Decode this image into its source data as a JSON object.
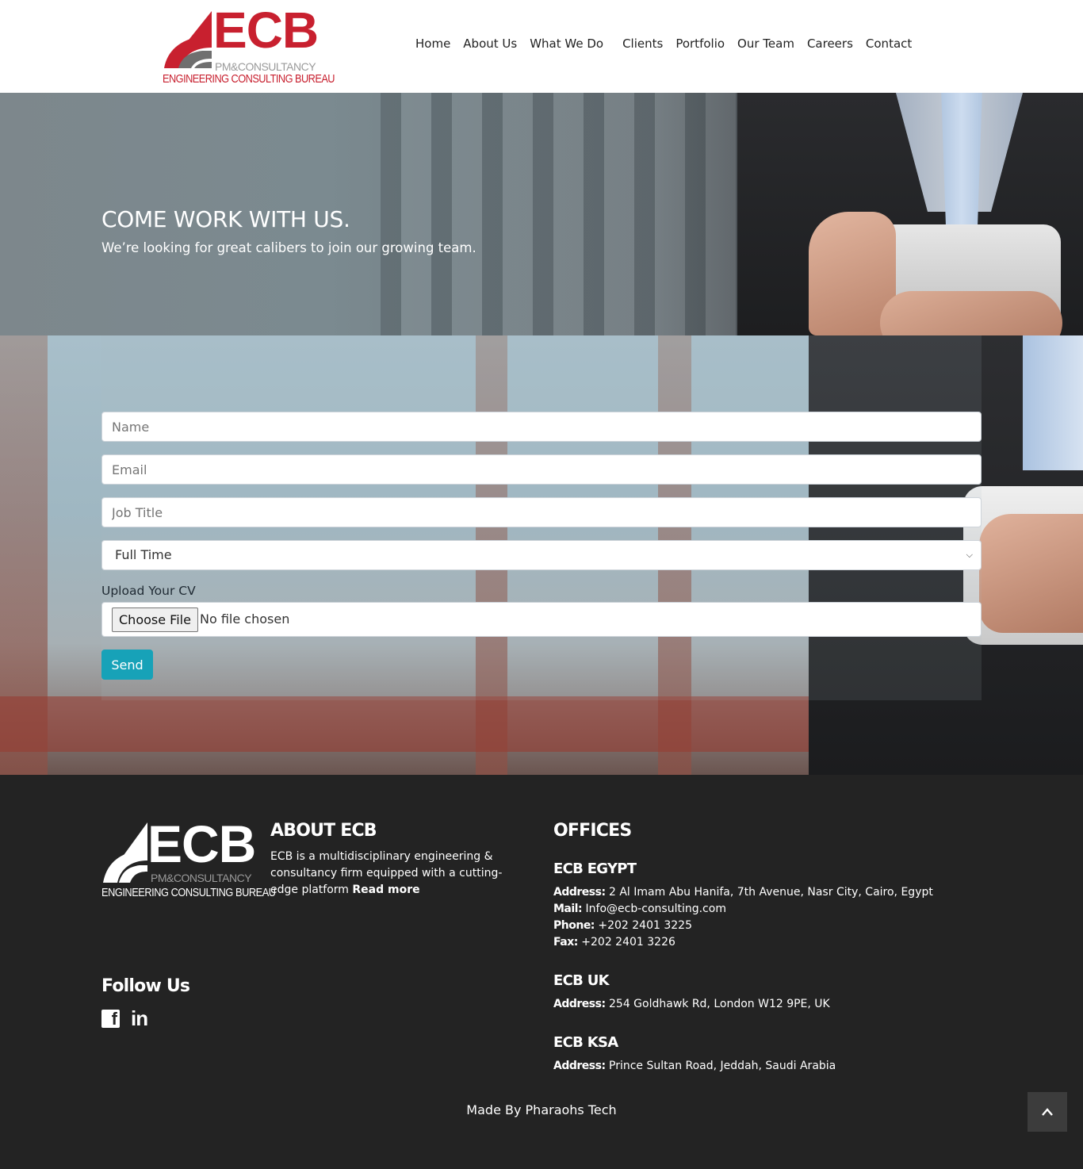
{
  "brand": {
    "logo_main": "ECB",
    "logo_sub": "PM&CONSULTANCY",
    "logo_tagline": "ENGINEERING CONSULTING BUREAU",
    "accent_color": "#c8202f"
  },
  "nav": {
    "items": [
      "Home",
      "About Us",
      "What We Do",
      "Clients",
      "Portfolio",
      "Our Team",
      "Careers",
      "Contact"
    ]
  },
  "hero": {
    "title": "COME WORK WITH US.",
    "subtitle": "We’re looking for great calibers to join our growing team."
  },
  "form": {
    "name_placeholder": "Name",
    "email_placeholder": "Email",
    "job_title_placeholder": "Job Title",
    "employment_type": "Full Time",
    "cv_label": "Upload Your CV",
    "file_button": "Choose File",
    "file_status": "No file chosen",
    "send_label": "Send",
    "send_color": "#17a2b8"
  },
  "footer": {
    "about_title": "ABOUT ECB",
    "about_text": "ECB is a multidisciplinary engineering & consultancy firm equipped with a cutting-edge platform",
    "read_more": "Read more",
    "offices_title": "OFFICES",
    "offices": [
      {
        "name": "ECB EGYPT",
        "address_label": "Address:",
        "address": "2 Al Imam Abu Hanifa, 7th Avenue, Nasr City, Cairo, Egypt",
        "mail_label": "Mail:",
        "mail": "Info@ecb-consulting.com",
        "phone_label": "Phone:",
        "phone": "+202 2401 3225",
        "fax_label": "Fax:",
        "fax": "+202 2401 3226"
      },
      {
        "name": "ECB UK",
        "address_label": "Address:",
        "address": "254 Goldhawk Rd, London W12 9PE, UK"
      },
      {
        "name": "ECB KSA",
        "address_label": "Address:",
        "address": "Prince Sultan Road, Jeddah, Saudi Arabia"
      }
    ],
    "follow_title": "Follow Us",
    "social_icons": [
      "facebook-icon",
      "linkedin-icon"
    ],
    "made_by": "Made By Pharaohs Tech",
    "background": "#232323"
  }
}
